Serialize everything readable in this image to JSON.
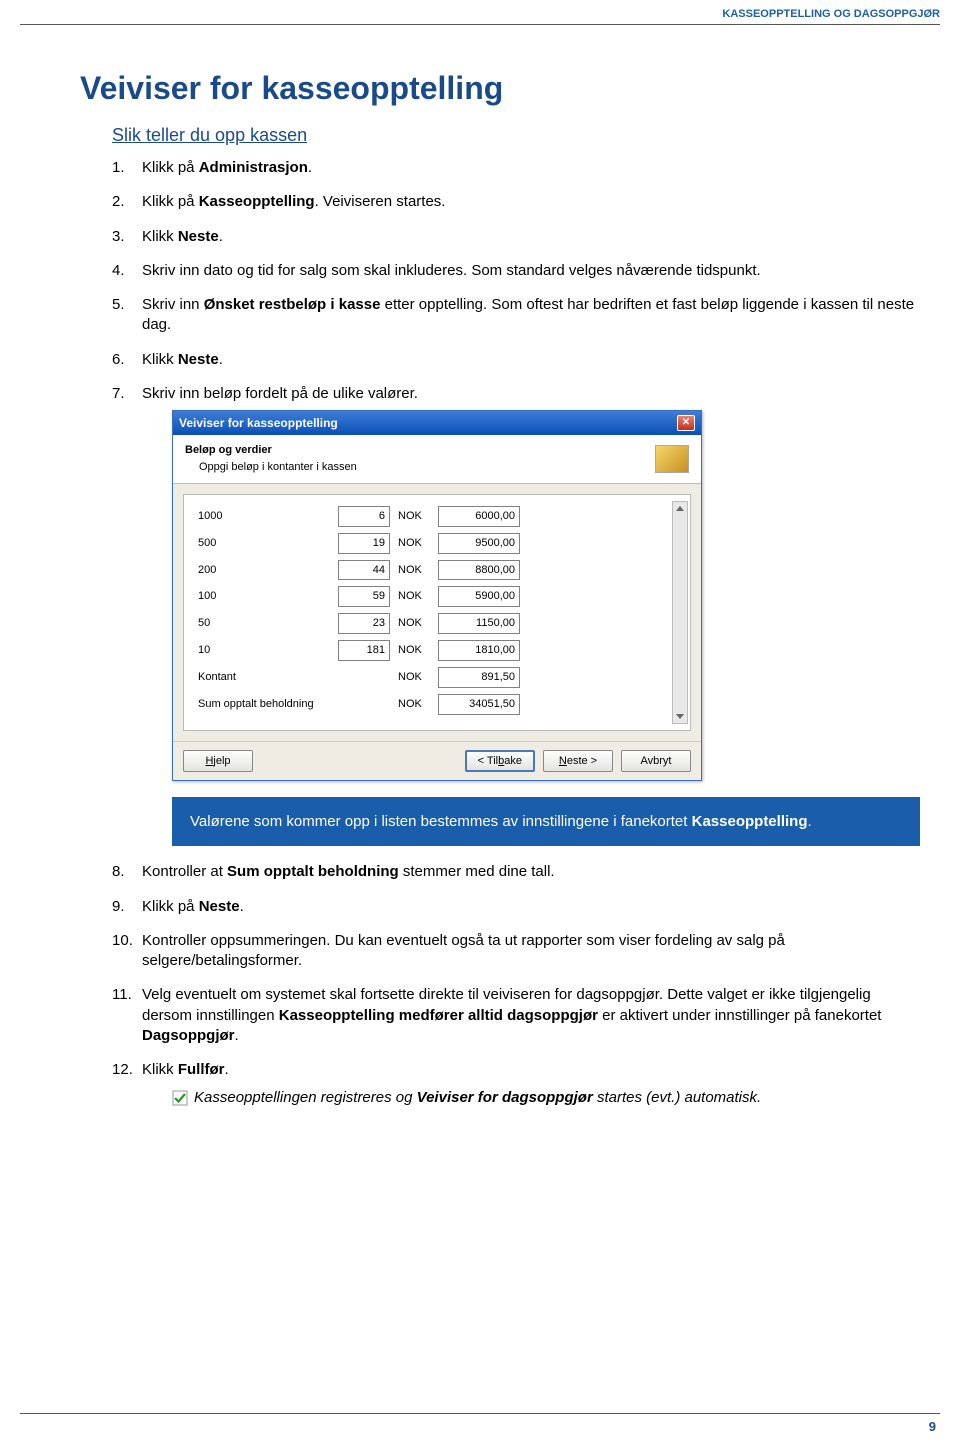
{
  "header": "KASSEOPPTELLING OG DAGSOPPGJØR",
  "title": "Veiviser for kasseopptelling",
  "subheading": "Slik teller du opp kassen",
  "steps_1_7": [
    {
      "pre": "Klikk på ",
      "bold": "Administrasjon",
      "post": "."
    },
    {
      "pre": "Klikk på ",
      "bold": "Kasseopptelling",
      "post": ". Veiviseren startes."
    },
    {
      "pre": "Klikk ",
      "bold": "Neste",
      "post": "."
    },
    {
      "pre": "Skriv inn dato og tid for salg som skal inkluderes. Som standard velges nåværende tidspunkt.",
      "bold": "",
      "post": ""
    },
    {
      "pre": "Skriv inn ",
      "bold": "Ønsket restbeløp i kasse",
      "post": " etter opptelling. Som oftest har bedriften et fast beløp liggende i kassen til neste dag."
    },
    {
      "pre": "Klikk ",
      "bold": "Neste",
      "post": "."
    },
    {
      "pre": "Skriv inn beløp fordelt på de ulike valører.",
      "bold": "",
      "post": ""
    }
  ],
  "wizard": {
    "title": "Veiviser for kasseopptelling",
    "header_title": "Beløp og verdier",
    "header_sub": "Oppgi beløp i kontanter i kassen",
    "currency": "NOK",
    "rows": [
      {
        "label": "1000",
        "qty": "6",
        "amount": "6000,00"
      },
      {
        "label": "500",
        "qty": "19",
        "amount": "9500,00"
      },
      {
        "label": "200",
        "qty": "44",
        "amount": "8800,00"
      },
      {
        "label": "100",
        "qty": "59",
        "amount": "5900,00"
      },
      {
        "label": "50",
        "qty": "23",
        "amount": "1150,00"
      },
      {
        "label": "10",
        "qty": "181",
        "amount": "1810,00"
      },
      {
        "label": "Kontant",
        "qty": "",
        "amount": "891,50"
      },
      {
        "label": "Sum opptalt beholdning",
        "qty": "",
        "amount": "34051,50"
      }
    ],
    "buttons": {
      "help": "Hjelp",
      "back": "< Tilbake",
      "next": "Neste >",
      "cancel": "Avbryt"
    }
  },
  "note": {
    "pre": "Valørene som kommer opp i listen bestemmes av innstillingene i fanekortet ",
    "bold": "Kasseopptelling",
    "post": "."
  },
  "steps_8_12": [
    {
      "n": "8",
      "pre": "Kontroller at ",
      "bold": "Sum opptalt beholdning",
      "post": " stemmer med dine tall."
    },
    {
      "n": "9",
      "pre": "Klikk på ",
      "bold": "Neste",
      "post": "."
    },
    {
      "n": "10",
      "pre": "Kontroller oppsummeringen. Du kan eventuelt også ta ut rapporter som viser fordeling av salg på selgere/betalingsformer.",
      "bold": "",
      "post": ""
    },
    {
      "n": "11",
      "pre": "Velg eventuelt om systemet skal fortsette direkte til veiviseren for dagsoppgjør. Dette valget er ikke tilgjengelig dersom innstillingen ",
      "bold": "Kasseopptelling medfører alltid dagsoppgjør",
      "post": " er aktivert under innstillinger på fanekortet ",
      "bold2": "Dagsoppgjør",
      "post2": "."
    },
    {
      "n": "12",
      "pre": "Klikk ",
      "bold": "Fullfør",
      "post": "."
    }
  ],
  "checkline": {
    "pre": "Kasseopptellingen registreres og ",
    "bold": "Veiviser for dagsoppgjør",
    "post": " startes (evt.) automatisk."
  },
  "page_number": "9"
}
